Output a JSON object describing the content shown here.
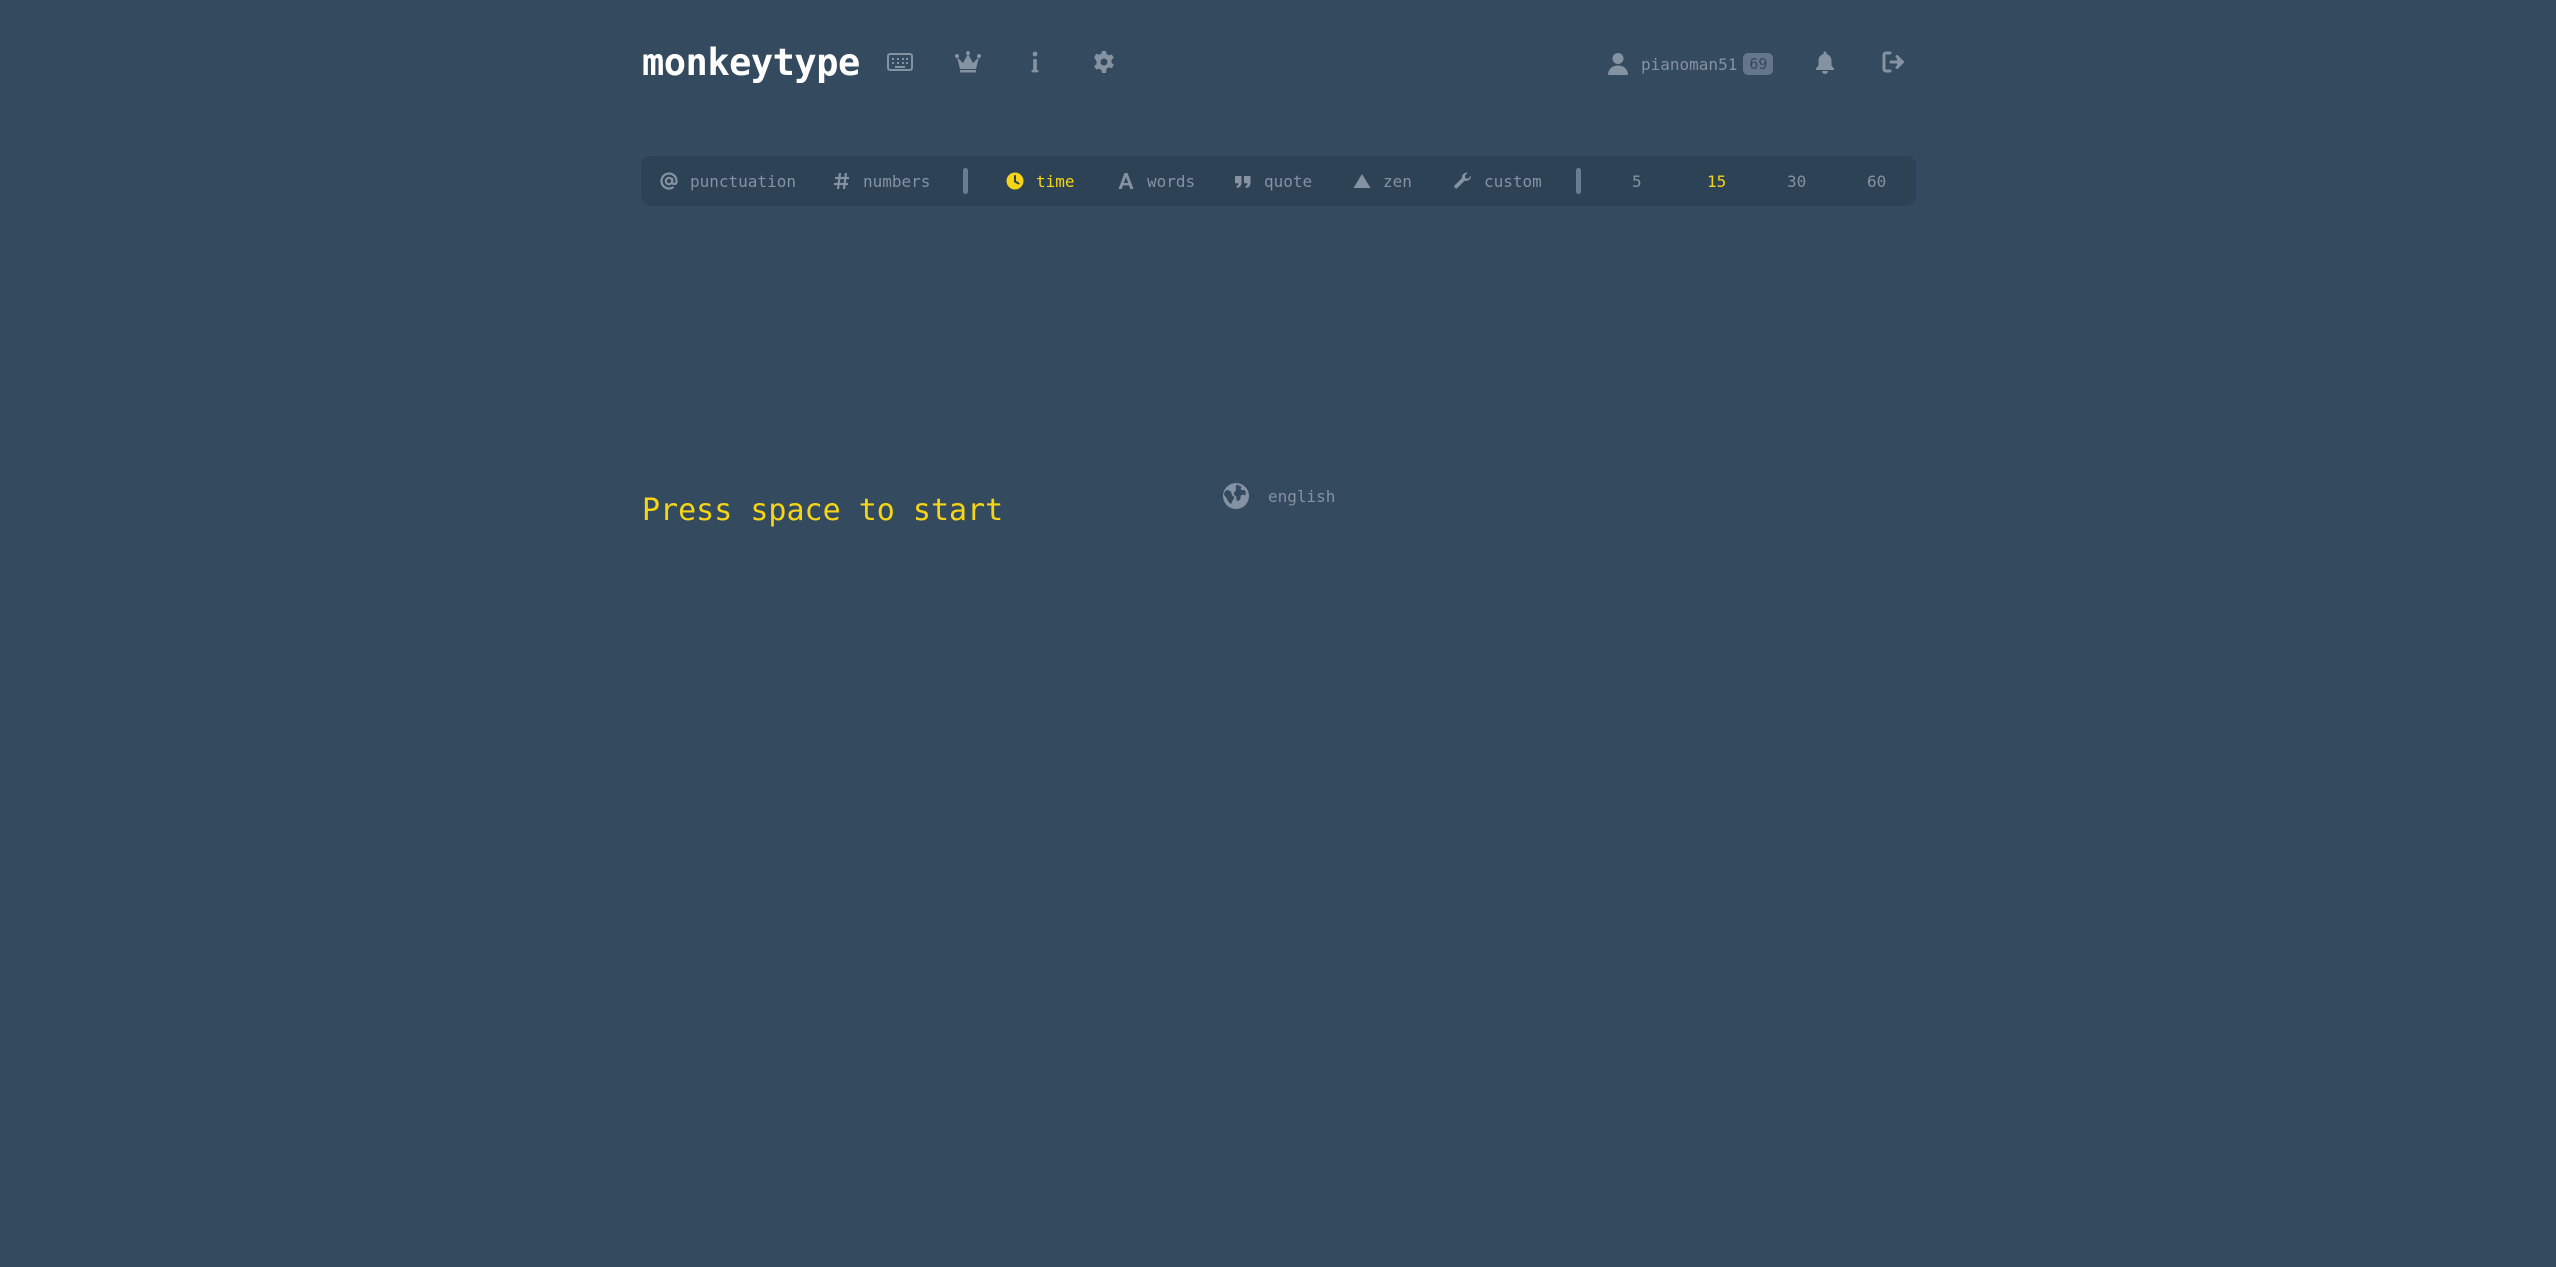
{
  "header": {
    "logo": "monkeytype",
    "nav_icons": [
      "keyboard-icon",
      "crown-icon",
      "info-icon",
      "gear-icon"
    ],
    "account": {
      "username": "pianoman51",
      "level": "69"
    },
    "right_icons": [
      "bell-icon",
      "logout-icon"
    ]
  },
  "config_bar": {
    "toggles": [
      {
        "label": "punctuation",
        "icon": "at-icon",
        "active": false
      },
      {
        "label": "numbers",
        "icon": "hash-icon",
        "active": false
      }
    ],
    "modes": [
      {
        "label": "time",
        "icon": "clock-icon",
        "active": true
      },
      {
        "label": "words",
        "icon": "font-icon",
        "active": false
      },
      {
        "label": "quote",
        "icon": "quote-icon",
        "active": false
      },
      {
        "label": "zen",
        "icon": "mountain-icon",
        "active": false
      },
      {
        "label": "custom",
        "icon": "wrench-icon",
        "active": false
      }
    ],
    "durations": [
      {
        "label": "5",
        "active": false
      },
      {
        "label": "15",
        "active": true
      },
      {
        "label": "30",
        "active": false
      },
      {
        "label": "60",
        "active": false
      }
    ]
  },
  "language": {
    "label": "english",
    "icon": "globe-icon"
  },
  "prompt": "Press space to start",
  "colors": {
    "background": "#344a5f",
    "bar": "#2e4255",
    "muted": "#8492a2",
    "accent": "#f5d515",
    "logo": "#ffffff"
  }
}
